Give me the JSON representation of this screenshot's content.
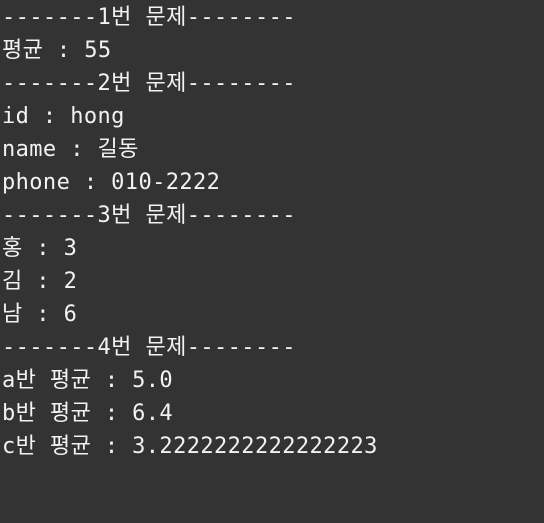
{
  "console": {
    "background": "#333333",
    "text_color": "#f2f2f2",
    "lines": [
      "-------1번 문제--------",
      "평균 : 55",
      "-------2번 문제--------",
      "id : hong",
      "name : 길동",
      "phone : 010-2222",
      "-------3번 문제--------",
      "홍 : 3",
      "김 : 2",
      "남 : 6",
      "-------4번 문제--------",
      "a반 평균 : 5.0",
      "b반 평균 : 6.4",
      "c반 평균 : 3.2222222222222223"
    ]
  }
}
